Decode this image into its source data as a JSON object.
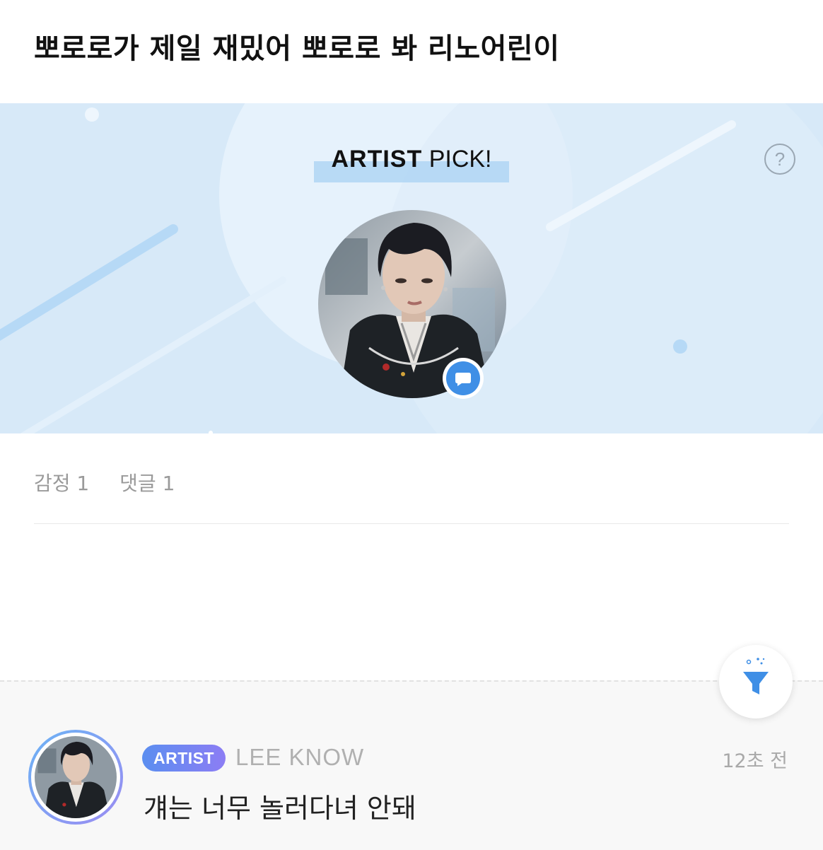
{
  "post": {
    "title": "뽀로로가 제일 재밌어 뽀로로 봐 리노어린이"
  },
  "artist_pick": {
    "label_strong": "ARTIST",
    "label_light": "PICK!",
    "help_icon": "question-circle-icon",
    "help_symbol": "?",
    "badge_icon": "chat-bubble-icon",
    "accent_color": "#3f8fe6"
  },
  "stats": {
    "emotions_label": "감정 1",
    "comments_label": "댓글 1"
  },
  "filter": {
    "icon": "funnel-icon",
    "color": "#3f8fe6"
  },
  "comments": [
    {
      "badge": "ARTIST",
      "author": "LEE KNOW",
      "time": "12초 전",
      "text": "걔는 너무 놀러다녀 안돼"
    }
  ]
}
